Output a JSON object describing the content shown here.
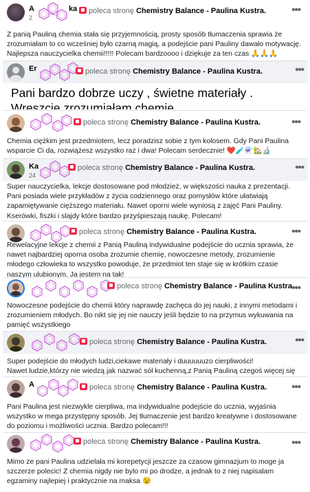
{
  "recommendation": {
    "verb": "poleca stronę",
    "page_name": "Chemistry Balance - Paulina Kustra."
  },
  "icons": {
    "menu": "more-dots-icon",
    "recommend": "recommend-flag-icon",
    "decoration": "hexagon-molecule-icon"
  },
  "colors": {
    "background": "#ffffff",
    "text": "#1c1e21",
    "secondary": "#65676b",
    "accent": "#1b74e4",
    "flag": "#f02849"
  },
  "reviews": [
    {
      "name": "A",
      "name_suffix": "ka",
      "meta": "2",
      "text": "Z panią Pauliną chemia stała się przyjemnością, prosty sposób tłumaczenia sprawia że zrozumiałam to co wcześniej było czarną magią, a podejście pani Pauliny dawało motywację. Najlepsza nauczycielka chemii!!!!! Polecam bardzoooo i dziękuje za ten czas 🙏🙏🙏"
    },
    {
      "name": "Er",
      "name_suffix": "",
      "meta": "",
      "text": "Pani bardzo dobrze uczy , świetne materiały . Wreszcie zrozumiałam chemię."
    },
    {
      "name": "",
      "name_suffix": "",
      "meta": "",
      "text": "Chemia ciężkim jest przedmiotem, lecz poradzisz sobie z tym kolosem. Gdy Pani Paulina wsparcie Ci da, rozwiążesz wszystko raz i dwa! Polecam serdecznie! ❤️🧪⚗️🏡🔬"
    },
    {
      "name": "Ka",
      "name_suffix": "",
      "meta": "24",
      "text": "Super nauczycielka, lekcje dostosowane pod młodzież, w większości nauka z prezentacji. Pani posiada wiele przykładów z życia codziennego oraz pomysłów które ułatwiają zapamiętywanie cięższego materiału. Nawet oporni wiele wyniosą z zajęć Pani Pauliny. Kserówki, fiszki i slajdy które bardzo przyśpieszają naukę. Polecam!"
    },
    {
      "name": "",
      "name_suffix": "",
      "meta": "",
      "text": "Rewelacyjne lekcje z chemii z Panią Pauliną indywidualne podejście do ucznia sprawia, że nawet najbardziej oporna osoba zrozumie chemię, nowoczesne metody, zrozumienie młodego człowieka to wszystko powoduje, że przedmiot ten staje się w krótkim czasie naszym ulubionym. Ja jestem na tak!"
    },
    {
      "name": "",
      "name_suffix": "",
      "meta": "",
      "text": "Nowoczesne podejście do chemii który naprawdę zachęca do jej nauki, z innymi metodami i zrozumieniem młodych. Bo nikt się jej nie nauczy jeśli będzie to na przymus wykuwania na pamięć wszystkiego"
    },
    {
      "name": "",
      "name_suffix": "",
      "meta": "",
      "text": "Super podejście do młodych ludzi,ciekawe materiały i duuuuuuzo cierpliwości!\nNawet ludzie,którzy nie wiedzą jak nazwać sól kuchenną,z Panią Pauliną czegoś więcej się nauczą."
    },
    {
      "name": "A",
      "name_suffix": "",
      "meta": "",
      "text": "Pani Paulina jest niezwykle cierpliwa, ma indywidualne podejście do ucznia, wyjaśnia wszystko w mega przystępny sposób. Jej tłumaczenie jest bardzo kreatywne i dostosowane do poziomu i możliwości ucznia. Bardzo polecam!!!"
    },
    {
      "name": "",
      "name_suffix": "",
      "meta": "",
      "text": "Mimo ze pani Paulina udzielała mi korepetycji jeszcze za czasow gimnazjum to moge ja szczerze polecic! Z chemia nigdy nie bylo mi po drodze, a jednak to z niej napisalam egzaminy najlepiej i praktycznie na maksa 😉"
    }
  ]
}
